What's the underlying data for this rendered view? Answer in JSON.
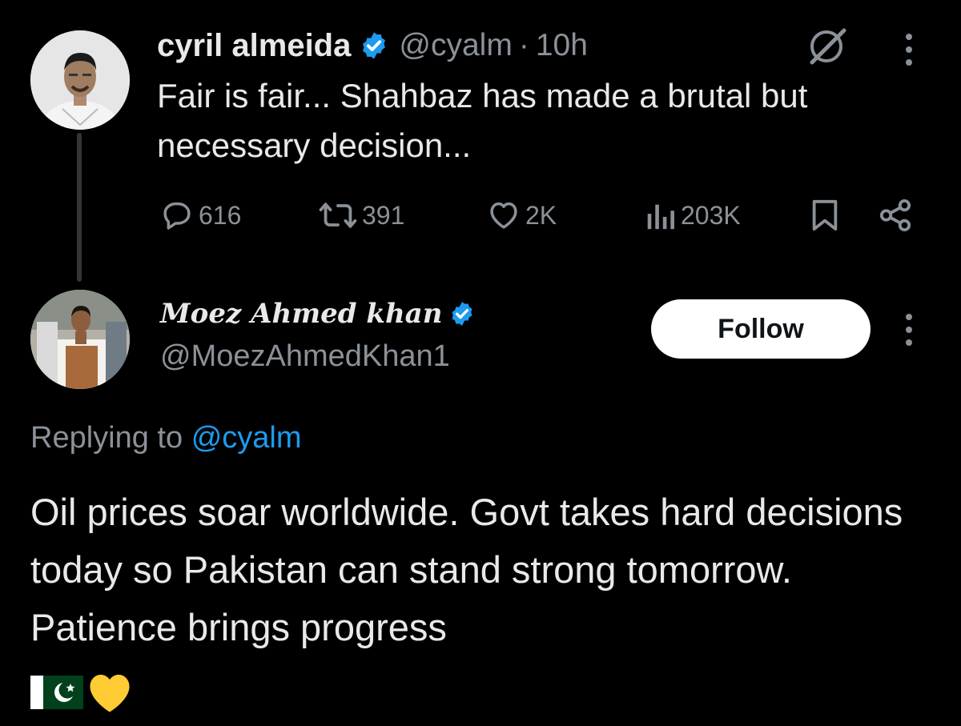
{
  "original_tweet": {
    "author_name": "cyril almeida",
    "handle": "@cyalm",
    "separator": "·",
    "time": "10h",
    "text_line1": "Fair is fair... Shahbaz has made a brutal but",
    "text_line2": "necessary decision...",
    "replies": "616",
    "reposts": "391",
    "likes": "2K",
    "views": "203K",
    "avatar_icon": "profile-photo",
    "grok-icon": "grok-icon"
  },
  "reply_tweet": {
    "author_name": "Moez Ahmed khan",
    "handle": "@MoezAhmedKhan1",
    "follow_label": "Follow",
    "replying_to_prefix": "Replying to",
    "replying_to_mention": "@cyalm",
    "text": "Oil prices soar worldwide. Govt takes hard decisions today so Pakistan can stand strong tomorrow. Patience brings progress",
    "emojis": [
      "pakistan-flag",
      "yellow-heart"
    ]
  },
  "colors": {
    "background": "#000000",
    "text": "#e7e9ea",
    "muted": "#8b9198",
    "accent": "#1d9bf0",
    "heart": "#ffcc33",
    "flag_green": "#01411c"
  }
}
